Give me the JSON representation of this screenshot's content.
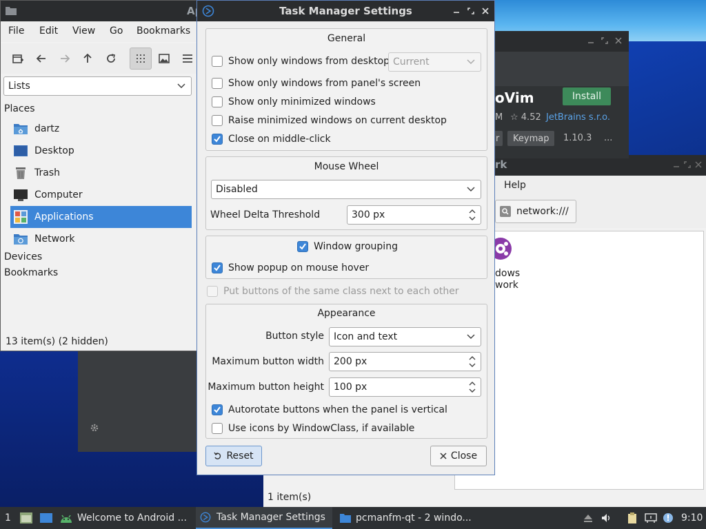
{
  "file_manager": {
    "title": "Ap",
    "menu": [
      "File",
      "Edit",
      "View",
      "Go",
      "Bookmarks"
    ],
    "side_pane_mode": "Lists",
    "places_header": "Places",
    "places": [
      "dartz",
      "Desktop",
      "Trash",
      "Computer",
      "Applications",
      "Network"
    ],
    "selected_place": "Applications",
    "devices_header": "Devices",
    "bookmarks_header": "Bookmarks",
    "status": "13 item(s) (2 hidden)"
  },
  "plugin_panel": {
    "name": "oVim",
    "install_label": "Install",
    "size": "M",
    "rating": "☆ 4.52",
    "vendor": "JetBrains s.r.o.",
    "tag_1": "r",
    "tag_2": "Keymap",
    "version": "1.10.3",
    "more": "..."
  },
  "network_window": {
    "title_fragment": "rk",
    "menu_help": "Help",
    "location": "network:///",
    "item_label_1": "dows",
    "item_label_2": "work",
    "status": "1 item(s)"
  },
  "task_manager": {
    "title": "Task Manager Settings",
    "general": {
      "title": "General",
      "show_only_desktop": "Show only windows from desktop",
      "desktop_combo": "Current",
      "panel_screen": "Show only windows from panel's screen",
      "minimized": "Show only minimized windows",
      "raise_minimized": "Raise minimized windows on current desktop",
      "close_middle": "Close on middle-click"
    },
    "mouse_wheel": {
      "title": "Mouse Wheel",
      "mode": "Disabled",
      "threshold_label": "Wheel Delta Threshold",
      "threshold_value": "300 px"
    },
    "grouping": {
      "window_grouping": "Window grouping",
      "popup_hover": "Show popup on mouse hover"
    },
    "same_class": "Put buttons of the same class next to each other",
    "appearance": {
      "title": "Appearance",
      "button_style_label": "Button style",
      "button_style_value": "Icon and text",
      "max_width_label": "Maximum button width",
      "max_width_value": "200 px",
      "max_height_label": "Maximum button height",
      "max_height_value": "100 px",
      "autorotate": "Autorotate buttons when the panel is vertical",
      "window_class_icons": "Use icons by WindowClass, if available"
    },
    "reset_label": "Reset",
    "close_label": "Close"
  },
  "taskbar": {
    "desktop_number": "1",
    "tasks": [
      "Welcome to Android ...",
      "Task Manager Settings",
      "pcmanfm-qt - 2 windo..."
    ],
    "clock": "9:10"
  },
  "colors": {
    "accent": "#3d86d8",
    "title_bar": "#2a2c2e",
    "install_green": "#3d8a5a",
    "vendor_link": "#5aa3e8"
  }
}
